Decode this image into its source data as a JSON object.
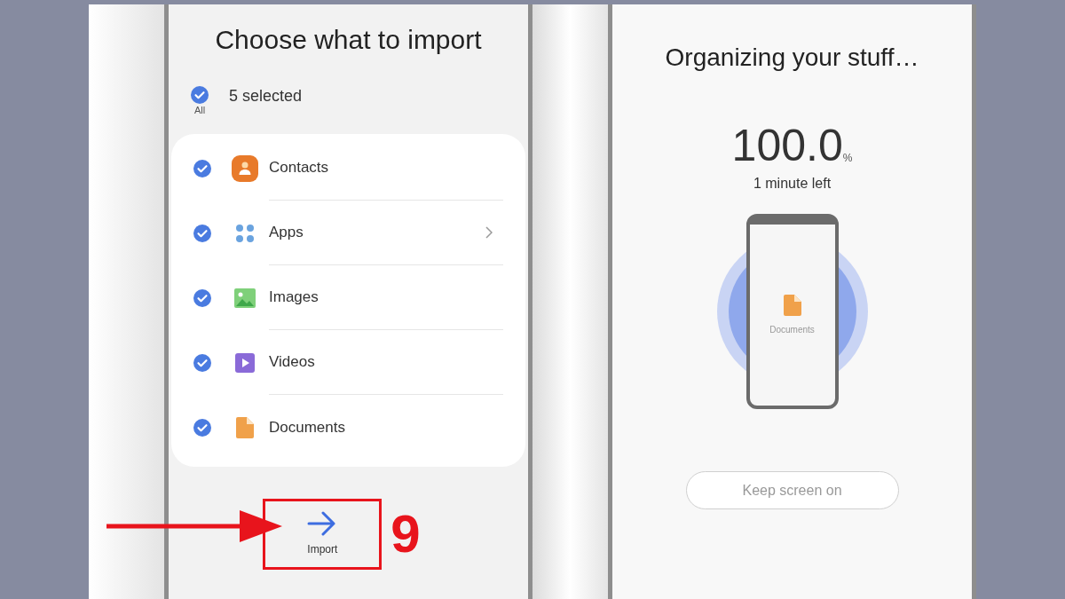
{
  "left_screen": {
    "title": "Choose what to import",
    "select_all": {
      "label": "All",
      "checked": true
    },
    "summary": "5 selected",
    "items": [
      {
        "label": "Contacts",
        "kind": "contacts",
        "checked": true,
        "chevron": false
      },
      {
        "label": "Apps",
        "kind": "apps",
        "checked": true,
        "chevron": true
      },
      {
        "label": "Images",
        "kind": "images",
        "checked": true,
        "chevron": false
      },
      {
        "label": "Videos",
        "kind": "videos",
        "checked": true,
        "chevron": false
      },
      {
        "label": "Documents",
        "kind": "documents",
        "checked": true,
        "chevron": false
      }
    ],
    "import_button": {
      "label": "Import"
    }
  },
  "annotation": {
    "step": "9"
  },
  "right_screen": {
    "title": "Organizing your stuff…",
    "percent": "100.0",
    "percent_unit": "%",
    "time_left": "1 minute left",
    "current_item": {
      "label": "Documents"
    },
    "button": "Keep screen on"
  }
}
